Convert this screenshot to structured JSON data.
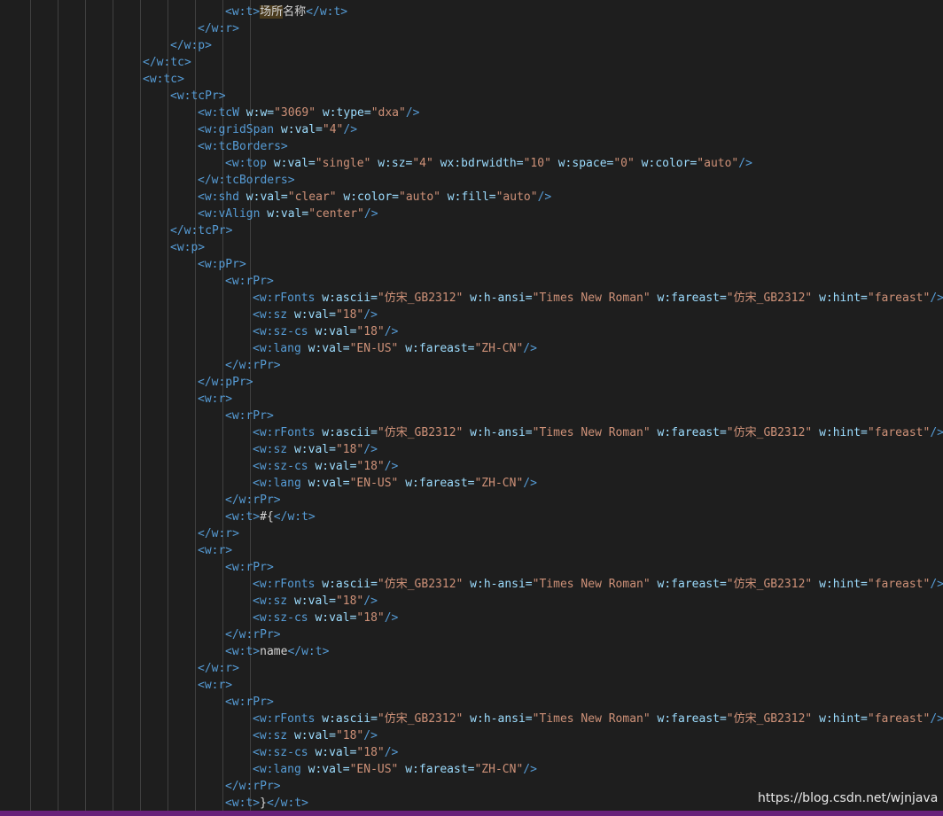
{
  "editor": {
    "colors": {
      "background": "#1e1e1e",
      "tag": "#569cd6",
      "attr": "#9cdcfe",
      "string": "#ce9178",
      "text": "#d4d4d4",
      "guide": "#404040",
      "status_bar": "#68217a"
    },
    "lines": [
      {
        "indent": 7,
        "tokens": [
          {
            "t": "tag",
            "v": "<w:t>"
          },
          {
            "t": "hl",
            "v": "场所"
          },
          {
            "t": "txt",
            "v": "名称"
          },
          {
            "t": "tag",
            "v": "</w:t>"
          }
        ]
      },
      {
        "indent": 6,
        "tokens": [
          {
            "t": "tag",
            "v": "</w:r>"
          }
        ]
      },
      {
        "indent": 5,
        "tokens": [
          {
            "t": "tag",
            "v": "</w:p>"
          }
        ]
      },
      {
        "indent": 4,
        "tokens": [
          {
            "t": "tag",
            "v": "</w:tc>"
          }
        ]
      },
      {
        "indent": 4,
        "tokens": [
          {
            "t": "tag",
            "v": "<w:tc>"
          }
        ]
      },
      {
        "indent": 5,
        "tokens": [
          {
            "t": "tag",
            "v": "<w:tcPr>"
          }
        ]
      },
      {
        "indent": 6,
        "tokens": [
          {
            "t": "tag",
            "v": "<w:tcW "
          },
          {
            "t": "attr",
            "v": "w:w="
          },
          {
            "t": "str",
            "v": "\"3069\""
          },
          {
            "t": "attr",
            "v": " w:type="
          },
          {
            "t": "str",
            "v": "\"dxa\""
          },
          {
            "t": "tag",
            "v": "/>"
          }
        ]
      },
      {
        "indent": 6,
        "tokens": [
          {
            "t": "tag",
            "v": "<w:gridSpan "
          },
          {
            "t": "attr",
            "v": "w:val="
          },
          {
            "t": "str",
            "v": "\"4\""
          },
          {
            "t": "tag",
            "v": "/>"
          }
        ]
      },
      {
        "indent": 6,
        "tokens": [
          {
            "t": "tag",
            "v": "<w:tcBorders>"
          }
        ]
      },
      {
        "indent": 7,
        "tokens": [
          {
            "t": "tag",
            "v": "<w:top "
          },
          {
            "t": "attr",
            "v": "w:val="
          },
          {
            "t": "str",
            "v": "\"single\""
          },
          {
            "t": "attr",
            "v": " w:sz="
          },
          {
            "t": "str",
            "v": "\"4\""
          },
          {
            "t": "attr",
            "v": " wx:bdrwidth="
          },
          {
            "t": "str",
            "v": "\"10\""
          },
          {
            "t": "attr",
            "v": " w:space="
          },
          {
            "t": "str",
            "v": "\"0\""
          },
          {
            "t": "attr",
            "v": " w:color="
          },
          {
            "t": "str",
            "v": "\"auto\""
          },
          {
            "t": "tag",
            "v": "/>"
          }
        ]
      },
      {
        "indent": 6,
        "tokens": [
          {
            "t": "tag",
            "v": "</w:tcBorders>"
          }
        ]
      },
      {
        "indent": 6,
        "tokens": [
          {
            "t": "tag",
            "v": "<w:shd "
          },
          {
            "t": "attr",
            "v": "w:val="
          },
          {
            "t": "str",
            "v": "\"clear\""
          },
          {
            "t": "attr",
            "v": " w:color="
          },
          {
            "t": "str",
            "v": "\"auto\""
          },
          {
            "t": "attr",
            "v": " w:fill="
          },
          {
            "t": "str",
            "v": "\"auto\""
          },
          {
            "t": "tag",
            "v": "/>"
          }
        ]
      },
      {
        "indent": 6,
        "tokens": [
          {
            "t": "tag",
            "v": "<w:vAlign "
          },
          {
            "t": "attr",
            "v": "w:val="
          },
          {
            "t": "str",
            "v": "\"center\""
          },
          {
            "t": "tag",
            "v": "/>"
          }
        ]
      },
      {
        "indent": 5,
        "tokens": [
          {
            "t": "tag",
            "v": "</w:tcPr>"
          }
        ]
      },
      {
        "indent": 5,
        "tokens": [
          {
            "t": "tag",
            "v": "<w:p>"
          }
        ]
      },
      {
        "indent": 6,
        "tokens": [
          {
            "t": "tag",
            "v": "<w:pPr>"
          }
        ]
      },
      {
        "indent": 7,
        "tokens": [
          {
            "t": "tag",
            "v": "<w:rPr>"
          }
        ]
      },
      {
        "indent": 8,
        "tokens": [
          {
            "t": "tag",
            "v": "<w:rFonts "
          },
          {
            "t": "attr",
            "v": "w:ascii="
          },
          {
            "t": "str",
            "v": "\"仿宋_GB2312\""
          },
          {
            "t": "attr",
            "v": " w:h-ansi="
          },
          {
            "t": "str",
            "v": "\"Times New Roman\""
          },
          {
            "t": "attr",
            "v": " w:fareast="
          },
          {
            "t": "str",
            "v": "\"仿宋_GB2312\""
          },
          {
            "t": "attr",
            "v": " w:hint="
          },
          {
            "t": "str",
            "v": "\"fareast\""
          },
          {
            "t": "tag",
            "v": "/>"
          }
        ]
      },
      {
        "indent": 8,
        "tokens": [
          {
            "t": "tag",
            "v": "<w:sz "
          },
          {
            "t": "attr",
            "v": "w:val="
          },
          {
            "t": "str",
            "v": "\"18\""
          },
          {
            "t": "tag",
            "v": "/>"
          }
        ]
      },
      {
        "indent": 8,
        "tokens": [
          {
            "t": "tag",
            "v": "<w:sz-cs "
          },
          {
            "t": "attr",
            "v": "w:val="
          },
          {
            "t": "str",
            "v": "\"18\""
          },
          {
            "t": "tag",
            "v": "/>"
          }
        ]
      },
      {
        "indent": 8,
        "tokens": [
          {
            "t": "tag",
            "v": "<w:lang "
          },
          {
            "t": "attr",
            "v": "w:val="
          },
          {
            "t": "str",
            "v": "\"EN-US\""
          },
          {
            "t": "attr",
            "v": " w:fareast="
          },
          {
            "t": "str",
            "v": "\"ZH-CN\""
          },
          {
            "t": "tag",
            "v": "/>"
          }
        ]
      },
      {
        "indent": 7,
        "tokens": [
          {
            "t": "tag",
            "v": "</w:rPr>"
          }
        ]
      },
      {
        "indent": 6,
        "tokens": [
          {
            "t": "tag",
            "v": "</w:pPr>"
          }
        ]
      },
      {
        "indent": 6,
        "tokens": [
          {
            "t": "tag",
            "v": "<w:r>"
          }
        ]
      },
      {
        "indent": 7,
        "tokens": [
          {
            "t": "tag",
            "v": "<w:rPr>"
          }
        ]
      },
      {
        "indent": 8,
        "tokens": [
          {
            "t": "tag",
            "v": "<w:rFonts "
          },
          {
            "t": "attr",
            "v": "w:ascii="
          },
          {
            "t": "str",
            "v": "\"仿宋_GB2312\""
          },
          {
            "t": "attr",
            "v": " w:h-ansi="
          },
          {
            "t": "str",
            "v": "\"Times New Roman\""
          },
          {
            "t": "attr",
            "v": " w:fareast="
          },
          {
            "t": "str",
            "v": "\"仿宋_GB2312\""
          },
          {
            "t": "attr",
            "v": " w:hint="
          },
          {
            "t": "str",
            "v": "\"fareast\""
          },
          {
            "t": "tag",
            "v": "/>"
          }
        ]
      },
      {
        "indent": 8,
        "tokens": [
          {
            "t": "tag",
            "v": "<w:sz "
          },
          {
            "t": "attr",
            "v": "w:val="
          },
          {
            "t": "str",
            "v": "\"18\""
          },
          {
            "t": "tag",
            "v": "/>"
          }
        ]
      },
      {
        "indent": 8,
        "tokens": [
          {
            "t": "tag",
            "v": "<w:sz-cs "
          },
          {
            "t": "attr",
            "v": "w:val="
          },
          {
            "t": "str",
            "v": "\"18\""
          },
          {
            "t": "tag",
            "v": "/>"
          }
        ]
      },
      {
        "indent": 8,
        "tokens": [
          {
            "t": "tag",
            "v": "<w:lang "
          },
          {
            "t": "attr",
            "v": "w:val="
          },
          {
            "t": "str",
            "v": "\"EN-US\""
          },
          {
            "t": "attr",
            "v": " w:fareast="
          },
          {
            "t": "str",
            "v": "\"ZH-CN\""
          },
          {
            "t": "tag",
            "v": "/>"
          }
        ]
      },
      {
        "indent": 7,
        "tokens": [
          {
            "t": "tag",
            "v": "</w:rPr>"
          }
        ]
      },
      {
        "indent": 7,
        "tokens": [
          {
            "t": "tag",
            "v": "<w:t>"
          },
          {
            "t": "txt",
            "v": "#{"
          },
          {
            "t": "tag",
            "v": "</w:t>"
          }
        ]
      },
      {
        "indent": 6,
        "tokens": [
          {
            "t": "tag",
            "v": "</w:r>"
          }
        ]
      },
      {
        "indent": 6,
        "tokens": [
          {
            "t": "tag",
            "v": "<w:r>"
          }
        ]
      },
      {
        "indent": 7,
        "tokens": [
          {
            "t": "tag",
            "v": "<w:rPr>"
          }
        ]
      },
      {
        "indent": 8,
        "tokens": [
          {
            "t": "tag",
            "v": "<w:rFonts "
          },
          {
            "t": "attr",
            "v": "w:ascii="
          },
          {
            "t": "str",
            "v": "\"仿宋_GB2312\""
          },
          {
            "t": "attr",
            "v": " w:h-ansi="
          },
          {
            "t": "str",
            "v": "\"Times New Roman\""
          },
          {
            "t": "attr",
            "v": " w:fareast="
          },
          {
            "t": "str",
            "v": "\"仿宋_GB2312\""
          },
          {
            "t": "attr",
            "v": " w:hint="
          },
          {
            "t": "str",
            "v": "\"fareast\""
          },
          {
            "t": "tag",
            "v": "/>"
          }
        ]
      },
      {
        "indent": 8,
        "tokens": [
          {
            "t": "tag",
            "v": "<w:sz "
          },
          {
            "t": "attr",
            "v": "w:val="
          },
          {
            "t": "str",
            "v": "\"18\""
          },
          {
            "t": "tag",
            "v": "/>"
          }
        ]
      },
      {
        "indent": 8,
        "tokens": [
          {
            "t": "tag",
            "v": "<w:sz-cs "
          },
          {
            "t": "attr",
            "v": "w:val="
          },
          {
            "t": "str",
            "v": "\"18\""
          },
          {
            "t": "tag",
            "v": "/>"
          }
        ]
      },
      {
        "indent": 7,
        "tokens": [
          {
            "t": "tag",
            "v": "</w:rPr>"
          }
        ]
      },
      {
        "indent": 7,
        "tokens": [
          {
            "t": "tag",
            "v": "<w:t>"
          },
          {
            "t": "txt",
            "v": "name"
          },
          {
            "t": "tag",
            "v": "</w:t>"
          }
        ]
      },
      {
        "indent": 6,
        "tokens": [
          {
            "t": "tag",
            "v": "</w:r>"
          }
        ]
      },
      {
        "indent": 6,
        "tokens": [
          {
            "t": "tag",
            "v": "<w:r>"
          }
        ]
      },
      {
        "indent": 7,
        "tokens": [
          {
            "t": "tag",
            "v": "<w:rPr>"
          }
        ]
      },
      {
        "indent": 8,
        "tokens": [
          {
            "t": "tag",
            "v": "<w:rFonts "
          },
          {
            "t": "attr",
            "v": "w:ascii="
          },
          {
            "t": "str",
            "v": "\"仿宋_GB2312\""
          },
          {
            "t": "attr",
            "v": " w:h-ansi="
          },
          {
            "t": "str",
            "v": "\"Times New Roman\""
          },
          {
            "t": "attr",
            "v": " w:fareast="
          },
          {
            "t": "str",
            "v": "\"仿宋_GB2312\""
          },
          {
            "t": "attr",
            "v": " w:hint="
          },
          {
            "t": "str",
            "v": "\"fareast\""
          },
          {
            "t": "tag",
            "v": "/>"
          }
        ]
      },
      {
        "indent": 8,
        "tokens": [
          {
            "t": "tag",
            "v": "<w:sz "
          },
          {
            "t": "attr",
            "v": "w:val="
          },
          {
            "t": "str",
            "v": "\"18\""
          },
          {
            "t": "tag",
            "v": "/>"
          }
        ]
      },
      {
        "indent": 8,
        "tokens": [
          {
            "t": "tag",
            "v": "<w:sz-cs "
          },
          {
            "t": "attr",
            "v": "w:val="
          },
          {
            "t": "str",
            "v": "\"18\""
          },
          {
            "t": "tag",
            "v": "/>"
          }
        ]
      },
      {
        "indent": 8,
        "tokens": [
          {
            "t": "tag",
            "v": "<w:lang "
          },
          {
            "t": "attr",
            "v": "w:val="
          },
          {
            "t": "str",
            "v": "\"EN-US\""
          },
          {
            "t": "attr",
            "v": " w:fareast="
          },
          {
            "t": "str",
            "v": "\"ZH-CN\""
          },
          {
            "t": "tag",
            "v": "/>"
          }
        ]
      },
      {
        "indent": 7,
        "tokens": [
          {
            "t": "tag",
            "v": "</w:rPr>"
          }
        ]
      },
      {
        "indent": 7,
        "tokens": [
          {
            "t": "tag",
            "v": "<w:t>"
          },
          {
            "t": "txt",
            "v": "}"
          },
          {
            "t": "tag",
            "v": "</w:t>"
          }
        ]
      }
    ]
  },
  "watermark": "https://blog.csdn.net/wjnjava"
}
